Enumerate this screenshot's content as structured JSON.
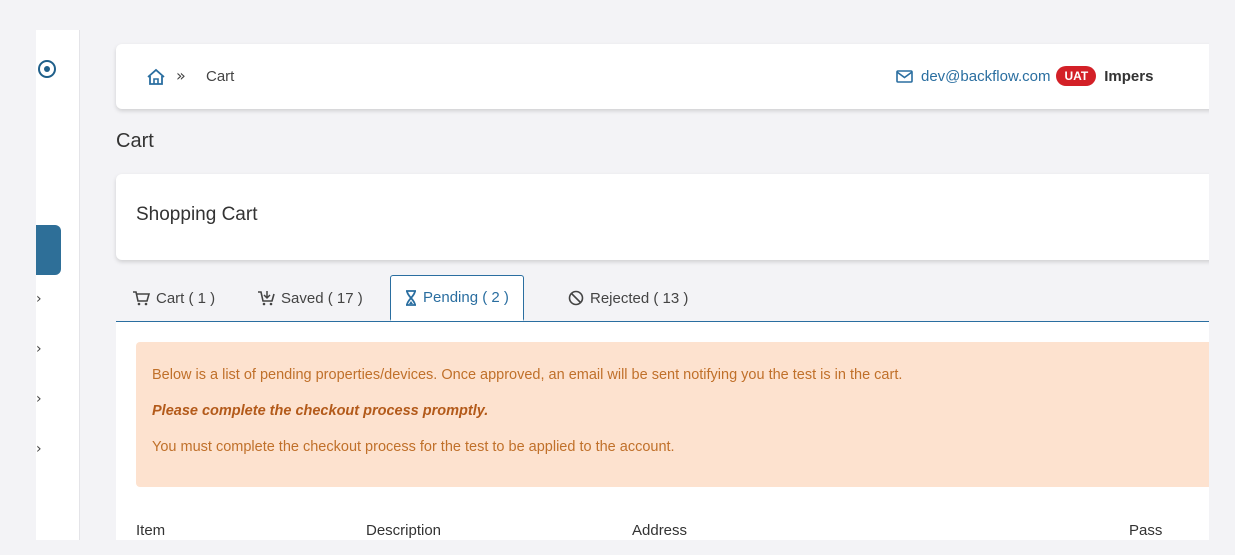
{
  "breadcrumb": {
    "separator": "»",
    "current": "Cart"
  },
  "user": {
    "email": "dev@backflow.com",
    "env_badge": "UAT",
    "impersonate_label": "Impers"
  },
  "page": {
    "title": "Cart",
    "card_title": "Shopping Cart"
  },
  "tabs": [
    {
      "label": "Cart ( 1 )",
      "icon": "cart-icon"
    },
    {
      "label": "Saved ( 17 )",
      "icon": "saved-cart-icon"
    },
    {
      "label": "Pending ( 2 )",
      "icon": "hourglass-icon",
      "active": true
    },
    {
      "label": "Rejected ( 13 )",
      "icon": "ban-icon"
    }
  ],
  "alert": {
    "line1": "Below is a list of pending properties/devices. Once approved, an email will be sent notifying you the test is in the cart.",
    "line2": "Please complete the checkout process promptly.",
    "line3": "You must complete the checkout process for the test to be applied to the account."
  },
  "table": {
    "columns": [
      "Item",
      "Description",
      "Address",
      "Pass"
    ]
  },
  "colors": {
    "accent": "#2a6ea0",
    "badge": "#d32027",
    "alert_bg": "#fde2cf",
    "alert_text": "#c0702a"
  }
}
